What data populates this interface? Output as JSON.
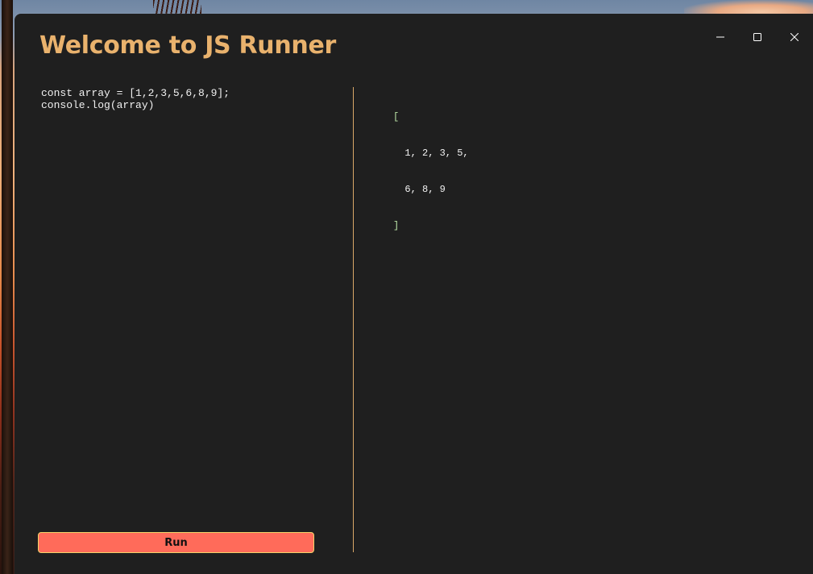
{
  "window": {
    "title": "Welcome to JS Runner",
    "controls": {
      "minimize_icon": "minimize-icon",
      "maximize_icon": "maximize-icon",
      "close_icon": "close-icon"
    }
  },
  "editor": {
    "code": "const array = [1,2,3,5,6,8,9];\nconsole.log(array)"
  },
  "output": {
    "lines": [
      "[",
      "  1, 2, 3, 5,",
      "  6, 8, 9",
      "]"
    ]
  },
  "run_button": {
    "label": "Run"
  },
  "colors": {
    "accent": "#e9b26d",
    "background": "#1f1f1f",
    "run_button": "#ff6b5a",
    "run_border": "#f3d46a",
    "bracket": "#b9e1a5"
  }
}
